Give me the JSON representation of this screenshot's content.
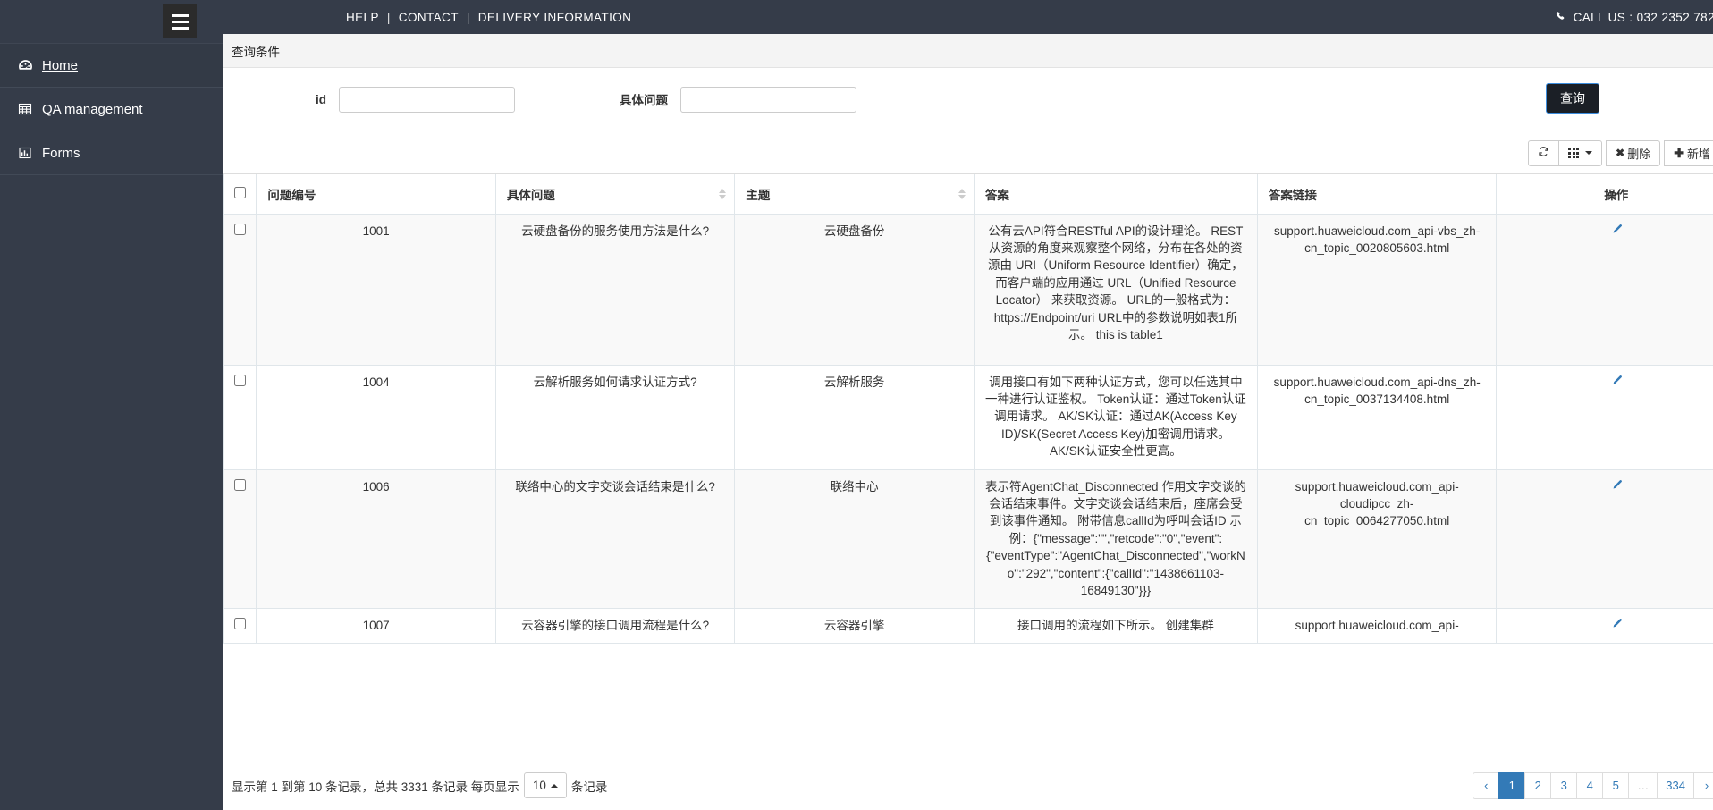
{
  "topbar": {
    "links": [
      "HELP",
      "CONTACT",
      "DELIVERY INFORMATION"
    ],
    "separator": "|",
    "phone_icon": "phone-icon",
    "call_us": "CALL US : 032 2352 782"
  },
  "sidebar": {
    "hamburger_icon": "hamburger-icon",
    "items": [
      {
        "label": " Home",
        "icon": "dashboard-icon",
        "active": true
      },
      {
        "label": "QA management",
        "icon": "table-icon",
        "active": false
      },
      {
        "label": "Forms",
        "icon": "chart-bar-icon",
        "active": false
      }
    ]
  },
  "query": {
    "panel_title": "查询条件",
    "fields": [
      {
        "label": "id",
        "value": "",
        "placeholder": ""
      },
      {
        "label": "具体问题",
        "value": "",
        "placeholder": ""
      }
    ],
    "submit_label": "查询"
  },
  "toolbar": {
    "refresh_icon": "refresh-icon",
    "columns_icon": "grid-columns-icon",
    "delete_icon": "cross-icon",
    "delete_label": "删除",
    "add_icon": "plus-icon",
    "add_label": "新增"
  },
  "table": {
    "columns": [
      {
        "key": "checkbox",
        "label": "",
        "sortable": false
      },
      {
        "key": "id",
        "label": "问题编号",
        "sortable": false
      },
      {
        "key": "question",
        "label": "具体问题",
        "sortable": true
      },
      {
        "key": "topic",
        "label": "主题",
        "sortable": true
      },
      {
        "key": "answer",
        "label": "答案",
        "sortable": false
      },
      {
        "key": "link",
        "label": "答案链接",
        "sortable": false
      },
      {
        "key": "op",
        "label": "操作",
        "sortable": false
      }
    ],
    "edit_icon": "pencil-icon",
    "rows": [
      {
        "id": "1001",
        "question": "云硬盘备份的服务使用方法是什么?",
        "topic": "云硬盘备份",
        "answer": "公有云API符合RESTful API的设计理论。 REST从资源的角度来观察整个网络，分布在各处的资源由 URI（Uniform Resource Identifier）确定，而客户端的应用通过 URL（Unified Resource Locator） 来获取资源。 URL的一般格式为：https://Endpoint/uri URL中的参数说明如表1所示。 this is table1",
        "link": "support.huaweicloud.com_api-vbs_zh-cn_topic_0020805603.html"
      },
      {
        "id": "1004",
        "question": "云解析服务如何请求认证方式?",
        "topic": "云解析服务",
        "answer": "调用接口有如下两种认证方式，您可以任选其中一种进行认证鉴权。 Token认证：通过Token认证调用请求。 AK/SK认证：通过AK(Access Key ID)/SK(Secret Access Key)加密调用请求。AK/SK认证安全性更高。",
        "link": "support.huaweicloud.com_api-dns_zh-cn_topic_0037134408.html"
      },
      {
        "id": "1006",
        "question": "联络中心的文字交谈会话结束是什么?",
        "topic": "联络中心",
        "answer": "表示符AgentChat_Disconnected 作用文字交谈的会话结束事件。文字交谈会话结束后，座席会受到该事件通知。 附带信息callId为呼叫会话ID 示例：{\"message\":\"\",\"retcode\":\"0\",\"event\":{\"eventType\":\"AgentChat_Disconnected\",\"workNo\":\"292\",\"content\":{\"callId\":\"1438661103-16849130\"}}}",
        "link": "support.huaweicloud.com_api-cloudipcc_zh-cn_topic_0064277050.html"
      },
      {
        "id": "1007",
        "question": "云容器引擎的接口调用流程是什么?",
        "topic": "云容器引擎",
        "answer": "接口调用的流程如下所示。 创建集群",
        "link": "support.huaweicloud.com_api-"
      }
    ]
  },
  "footer": {
    "info_prefix": "显示第 1 到第 10 条记录，总共 3331 条记录 每页显示",
    "page_size": "10",
    "info_suffix": "条记录",
    "pager": {
      "prev": "‹",
      "pages": [
        "1",
        "2",
        "3",
        "4",
        "5",
        "…",
        "334"
      ],
      "active": "1",
      "next": "›"
    }
  },
  "colors": {
    "sidebar_bg": "#353c49",
    "accent_blue": "#337ab7",
    "query_btn_bg": "#1b1f26"
  }
}
